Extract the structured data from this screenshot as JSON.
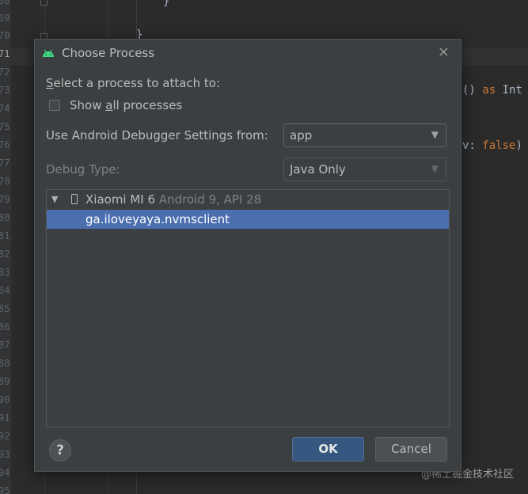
{
  "editor": {
    "line_numbers": [
      "68",
      "69",
      "70",
      "71",
      "72",
      "73",
      "74",
      "75",
      "76",
      "77",
      "78",
      "79",
      "80",
      "81",
      "82",
      "83",
      "84",
      "85",
      "86",
      "87",
      "88",
      "89",
      "90",
      "91",
      "92",
      "93",
      "94",
      "95"
    ],
    "code_fragments": {
      "brace_1": "}",
      "brace_2": "}",
      "cast_paren": "() ",
      "cast_as": "as",
      "cast_type": " Int",
      "arg_name": "v: ",
      "arg_value": "false",
      "arg_close": ")"
    },
    "watermark": "@稀土掘金技术社区"
  },
  "dialog": {
    "title": "Choose Process",
    "close_glyph": "×",
    "select_label_prefix": "",
    "select_label_mnemonic": "S",
    "select_label_rest": "elect a process to attach to:",
    "show_all_prefix": "Show ",
    "show_all_mnemonic": "a",
    "show_all_rest": "ll processes",
    "show_all_checked": false,
    "settings_label": "Use Android Debugger Settings from:",
    "settings_value": "app",
    "debug_type_label": "Debug Type:",
    "debug_type_value": "Java Only",
    "combo_arrow": "▼",
    "tree": {
      "expander": "▼",
      "device_name": "Xiaomi MI 6",
      "device_detail": " Android 9, API 28",
      "process": "ga.iloveyaya.nvmsclient"
    },
    "help_glyph": "?",
    "ok_label": "OK",
    "cancel_label": "Cancel"
  },
  "colors": {
    "accent": "#365880",
    "selection": "#4b6eaf",
    "android_green": "#3ddc84"
  }
}
